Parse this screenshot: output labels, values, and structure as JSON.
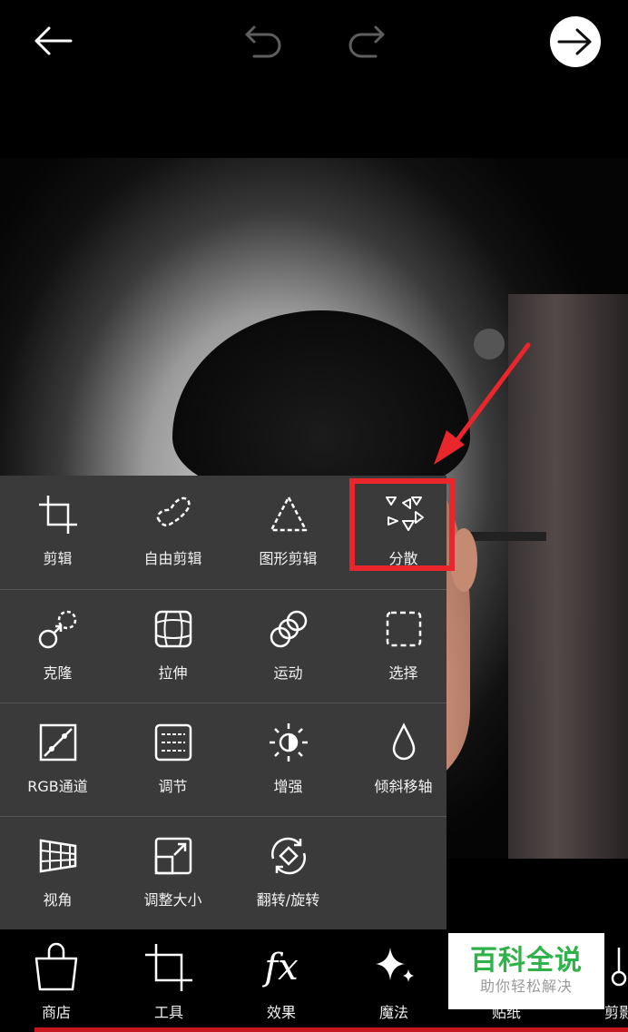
{
  "top_bar": {
    "back_icon": "arrow-left-icon",
    "undo_icon": "undo-icon",
    "redo_icon": "redo-icon",
    "next_icon": "arrow-right-circle-icon"
  },
  "tool_menu": {
    "rows": [
      [
        {
          "label": "剪辑",
          "icon": "crop-icon"
        },
        {
          "label": "自由剪辑",
          "icon": "free-crop-icon"
        },
        {
          "label": "图形剪辑",
          "icon": "shape-crop-icon"
        },
        {
          "label": "分散",
          "icon": "dispersion-icon"
        }
      ],
      [
        {
          "label": "克隆",
          "icon": "clone-icon"
        },
        {
          "label": "拉伸",
          "icon": "stretch-icon"
        },
        {
          "label": "运动",
          "icon": "motion-icon"
        },
        {
          "label": "选择",
          "icon": "select-icon"
        }
      ],
      [
        {
          "label": "RGB通道",
          "icon": "curves-icon"
        },
        {
          "label": "调节",
          "icon": "adjust-icon"
        },
        {
          "label": "增强",
          "icon": "enhance-icon"
        },
        {
          "label": "倾斜移轴",
          "icon": "tilt-shift-icon"
        }
      ],
      [
        {
          "label": "视角",
          "icon": "perspective-icon"
        },
        {
          "label": "调整大小",
          "icon": "resize-icon"
        },
        {
          "label": "翻转/旋转",
          "icon": "flip-rotate-icon"
        }
      ]
    ]
  },
  "bottom_tabs": [
    {
      "label": "商店",
      "icon": "shopping-bag-icon"
    },
    {
      "label": "工具",
      "icon": "crop-icon"
    },
    {
      "label": "效果",
      "icon": "fx-icon"
    },
    {
      "label": "魔法",
      "icon": "sparkle-icon"
    },
    {
      "label": "贴纸",
      "icon": "sticker-icon"
    },
    {
      "label": "剪影",
      "icon": "scissors-icon"
    }
  ],
  "bottom_fx_text": "fx",
  "watermark": {
    "title": "百科全说",
    "subtitle": "助你轻松解决"
  },
  "colors": {
    "highlight": "#e8262b",
    "watermark_green": "#2fb24a",
    "menu_bg": "#3a3a3a"
  }
}
